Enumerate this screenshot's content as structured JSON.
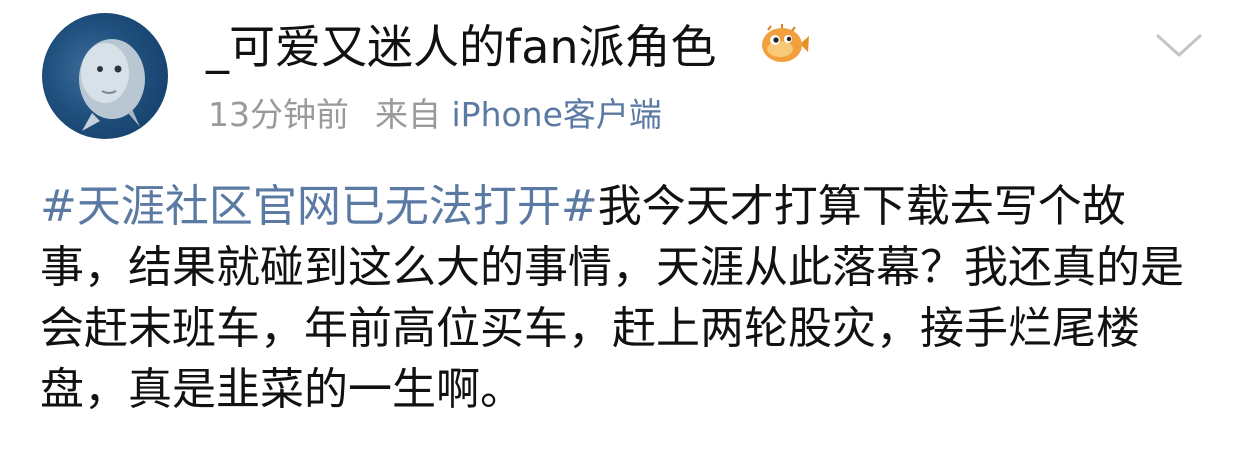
{
  "post": {
    "author": {
      "name": "_可爱又迷人的fan派角色",
      "avatar_icon": "sunfish-avatar",
      "badge_icon": "pufferfish-badge-icon"
    },
    "meta": {
      "time": "13分钟前",
      "source_label": "来自",
      "client": "iPhone客户端"
    },
    "menu_icon": "chevron-down-icon",
    "content": {
      "hashtag": "#天涯社区官网已无法打开#",
      "text": "我今天才打算下载去写个故事，结果就碰到这么大的事情，天涯从此落幕？我还真的是会赶末班车，年前高位买车，赶上两轮股灾，接手烂尾楼盘，真是韭菜的一生啊。"
    }
  },
  "colors": {
    "link": "#5b7aa3",
    "meta": "#9a9a9a",
    "text": "#111111",
    "avatar_bg": "#1f4f7d",
    "badge": "#f2a03d"
  }
}
